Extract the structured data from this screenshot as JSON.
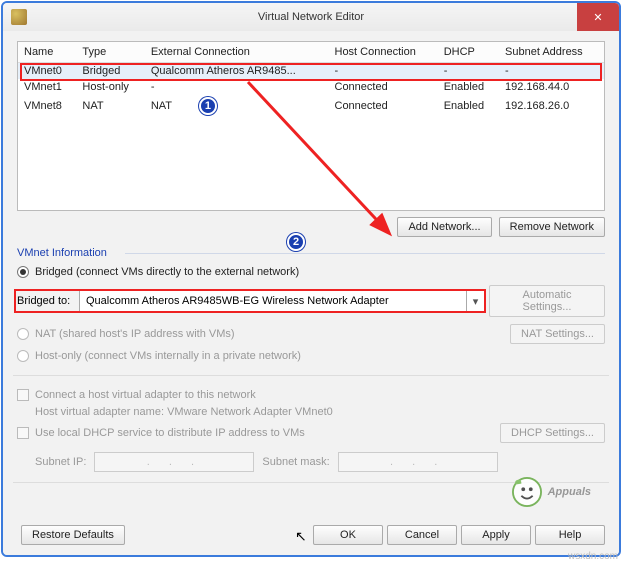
{
  "window": {
    "title": "Virtual Network Editor",
    "close": "✕"
  },
  "table": {
    "headers": [
      "Name",
      "Type",
      "External Connection",
      "Host Connection",
      "DHCP",
      "Subnet Address"
    ],
    "rows": [
      {
        "name": "VMnet0",
        "type": "Bridged",
        "ext": "Qualcomm Atheros AR9485...",
        "host": "-",
        "dhcp": "-",
        "subnet": "-",
        "selected": true
      },
      {
        "name": "VMnet1",
        "type": "Host-only",
        "ext": "-",
        "host": "Connected",
        "dhcp": "Enabled",
        "subnet": "192.168.44.0",
        "selected": false
      },
      {
        "name": "VMnet8",
        "type": "NAT",
        "ext": "NAT",
        "host": "Connected",
        "dhcp": "Enabled",
        "subnet": "192.168.26.0",
        "selected": false
      }
    ]
  },
  "annotations": {
    "badge1": "1",
    "badge2": "2"
  },
  "buttons": {
    "add_network": "Add Network...",
    "remove_network": "Remove Network",
    "automatic": "Automatic Settings...",
    "nat": "NAT Settings...",
    "dhcp": "DHCP Settings...",
    "restore": "Restore Defaults",
    "ok": "OK",
    "cancel": "Cancel",
    "apply": "Apply",
    "help": "Help"
  },
  "info": {
    "group": "VMnet Information",
    "bridged_label": "Bridged (connect VMs directly to the external network)",
    "bridged_to": "Bridged to:",
    "adapter": "Qualcomm Atheros AR9485WB-EG Wireless Network Adapter",
    "nat_label": "NAT (shared host's IP address with VMs)",
    "hostonly_label": "Host-only (connect VMs internally in a private network)",
    "hostconn_check": "Connect a host virtual adapter to this network",
    "hostconn_name": "Host virtual adapter name: VMware Network Adapter VMnet0",
    "dhcp_check": "Use local DHCP service to distribute IP address to VMs",
    "subnet_ip": "Subnet IP:",
    "ip_mask": ".   .   .",
    "subnet_mask": "Subnet mask:"
  },
  "watermark": "Appuals",
  "source": "wsxdn.com"
}
